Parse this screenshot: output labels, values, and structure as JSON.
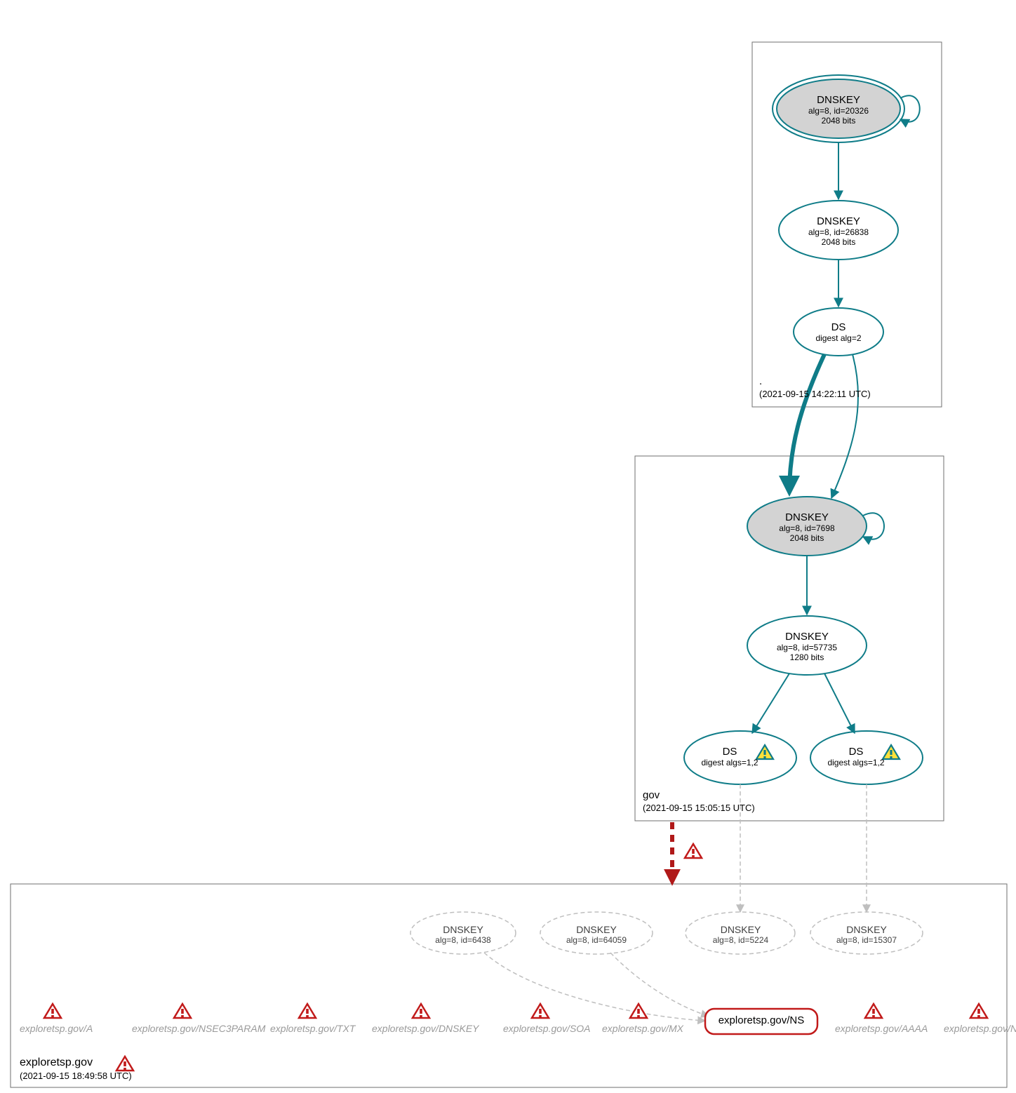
{
  "colors": {
    "teal": "#0f7c88",
    "red": "#b01919",
    "grey_stroke": "#bfbfbf",
    "grey_fill": "#d3d3d3"
  },
  "zones": {
    "root": {
      "label": ".",
      "timestamp": "(2021-09-15 14:22:11 UTC)",
      "nodes": {
        "ksk": {
          "title": "DNSKEY",
          "sub": "alg=8, id=20326",
          "sub2": "2048 bits"
        },
        "zsk": {
          "title": "DNSKEY",
          "sub": "alg=8, id=26838",
          "sub2": "2048 bits"
        },
        "ds": {
          "title": "DS",
          "sub": "digest alg=2"
        }
      }
    },
    "gov": {
      "label": "gov",
      "timestamp": "(2021-09-15 15:05:15 UTC)",
      "nodes": {
        "ksk": {
          "title": "DNSKEY",
          "sub": "alg=8, id=7698",
          "sub2": "2048 bits"
        },
        "zsk": {
          "title": "DNSKEY",
          "sub": "alg=8, id=57735",
          "sub2": "1280 bits"
        },
        "ds1": {
          "title": "DS",
          "sub": "digest algs=1,2"
        },
        "ds2": {
          "title": "DS",
          "sub": "digest algs=1,2"
        }
      }
    },
    "exploretsp": {
      "label": "exploretsp.gov",
      "timestamp": "(2021-09-15 18:49:58 UTC)",
      "dnskeys": {
        "k1": {
          "title": "DNSKEY",
          "sub": "alg=8, id=6438"
        },
        "k2": {
          "title": "DNSKEY",
          "sub": "alg=8, id=64059"
        },
        "k3": {
          "title": "DNSKEY",
          "sub": "alg=8, id=5224"
        },
        "k4": {
          "title": "DNSKEY",
          "sub": "alg=8, id=15307"
        }
      },
      "records": {
        "a": "exploretsp.gov/A",
        "nsec3param": "exploretsp.gov/NSEC3PARAM",
        "txt": "exploretsp.gov/TXT",
        "dnskey": "exploretsp.gov/DNSKEY",
        "soa": "exploretsp.gov/SOA",
        "mx": "exploretsp.gov/MX",
        "ns": "exploretsp.gov/NS",
        "aaaa": "exploretsp.gov/AAAA",
        "ns2": "exploretsp.gov/NS"
      }
    }
  },
  "icons": {
    "warning_triangle": "warning-triangle-icon",
    "error_triangle": "error-triangle-icon"
  }
}
